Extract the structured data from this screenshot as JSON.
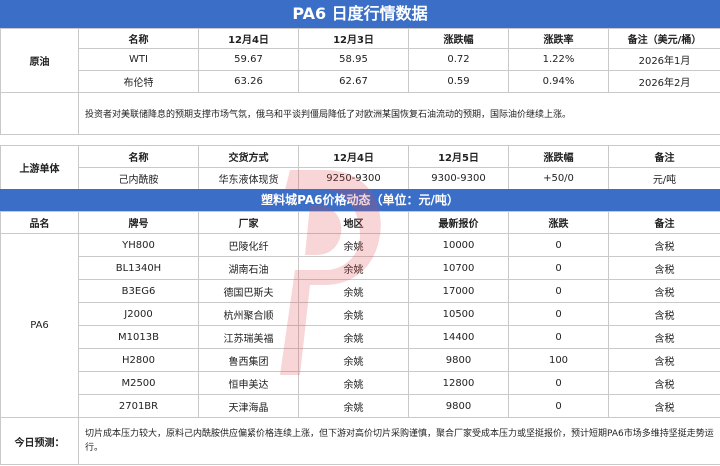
{
  "title": "PA6 日度行情数据",
  "crude": {
    "section_label": "原油",
    "headers": [
      "名称",
      "12月4日",
      "12月3日",
      "涨跌幅",
      "涨跌率",
      "备注（美元/桶）"
    ],
    "rows": [
      [
        "WTI",
        "59.67",
        "58.95",
        "0.72",
        "1.22%",
        "2026年1月"
      ],
      [
        "布伦特",
        "63.26",
        "62.67",
        "0.59",
        "0.94%",
        "2026年2月"
      ]
    ],
    "note": "投资者对美联储降息的预期支撑市场气氛，俄乌和平谈判僵局降低了对欧洲某国恢复石油流动的预期，国际油价继续上涨。"
  },
  "upstream": {
    "section_label": "上游单体",
    "headers": [
      "名称",
      "交货方式",
      "12月4日",
      "12月5日",
      "涨跌幅",
      "备注"
    ],
    "row": [
      "己内酰胺",
      "华东液体现货",
      "9250-9300",
      "9300-9300",
      "+50/0",
      "元/吨"
    ]
  },
  "pa6": {
    "banner": "塑料城PA6价格动态（单位：元/吨）",
    "headers": [
      "品名",
      "牌号",
      "厂家",
      "地区",
      "最新报价",
      "涨跌",
      "备注"
    ],
    "product": "PA6",
    "rows": [
      [
        "YH800",
        "巴陵化纤",
        "余姚",
        "10000",
        "0",
        "含税"
      ],
      [
        "BL1340H",
        "湖南石油",
        "余姚",
        "10700",
        "0",
        "含税"
      ],
      [
        "B3EG6",
        "德国巴斯夫",
        "余姚",
        "17000",
        "0",
        "含税"
      ],
      [
        "J2000",
        "杭州聚合顺",
        "余姚",
        "10500",
        "0",
        "含税"
      ],
      [
        "M1013B",
        "江苏瑞美福",
        "余姚",
        "14400",
        "0",
        "含税"
      ],
      [
        "H2800",
        "鲁西集团",
        "余姚",
        "9800",
        "100",
        "含税"
      ],
      [
        "M2500",
        "恒申美达",
        "余姚",
        "12800",
        "0",
        "含税"
      ],
      [
        "2701BR",
        "天津海晶",
        "余姚",
        "9800",
        "0",
        "含税"
      ]
    ]
  },
  "forecast": {
    "label": "今日预测：",
    "text": "切片成本压力较大，原料己内酰胺供应偏紧价格连续上涨，但下游对高价切片采购谨慎，聚合厂家受成本压力或坚挺报价，预计短期PA6市场多维持坚挺走势运行。"
  },
  "colors": {
    "header_blue": "#3b6fc7",
    "watermark_red": "#e0464a"
  }
}
